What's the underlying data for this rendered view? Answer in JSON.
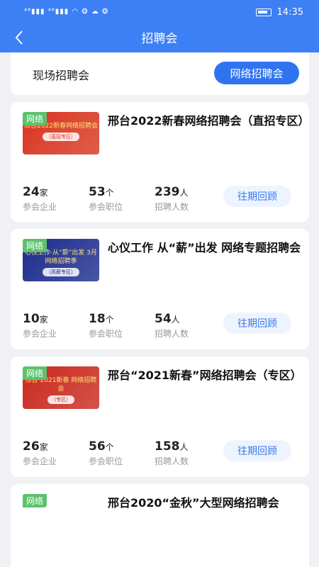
{
  "status_bar": {
    "signal_text": "⁴⁶▮▮▮ ⁴⁶▮▮▮ ◠ ❂ ☁ ❂",
    "time": "14:35"
  },
  "nav": {
    "title": "招聘会"
  },
  "tabs": {
    "onsite": "现场招聘会",
    "online": "网络招聘会"
  },
  "stat_labels": {
    "companies": "参会企业",
    "positions": "参会职位",
    "recruits": "招聘人数"
  },
  "units": {
    "companies": "家",
    "positions": "个",
    "recruits": "人"
  },
  "review_label": "往期回顾",
  "fairs": [
    {
      "tag": "网络",
      "title": "邢台2022新春网络招聘会（直招专区）",
      "thumb_text": "邢台2022新春网络招聘会",
      "thumb_sub": "（直招专区）",
      "companies": "24",
      "positions": "53",
      "recruits": "239",
      "thumb_color": "#d8341f"
    },
    {
      "tag": "网络",
      "title": "心仪工作 从“薪”出发 网络专题招聘会",
      "thumb_text": "心仪工作·从“薪”出发 3月网络招聘季",
      "thumb_sub": "（高薪专区）",
      "companies": "10",
      "positions": "18",
      "recruits": "54",
      "thumb_color": "#1b2c8c"
    },
    {
      "tag": "网络",
      "title": "邢台“2021新春”网络招聘会（专区）",
      "thumb_text": "邢台·2021新春 网络招聘会",
      "thumb_sub": "（专区）",
      "companies": "26",
      "positions": "56",
      "recruits": "158",
      "thumb_color": "#c9281e"
    },
    {
      "tag": "网络",
      "title": "邢台2020“金秋”大型网络招聘会",
      "thumb_text": "",
      "thumb_sub": "",
      "companies": "",
      "positions": "",
      "recruits": "",
      "thumb_color": "#ffffff"
    }
  ]
}
